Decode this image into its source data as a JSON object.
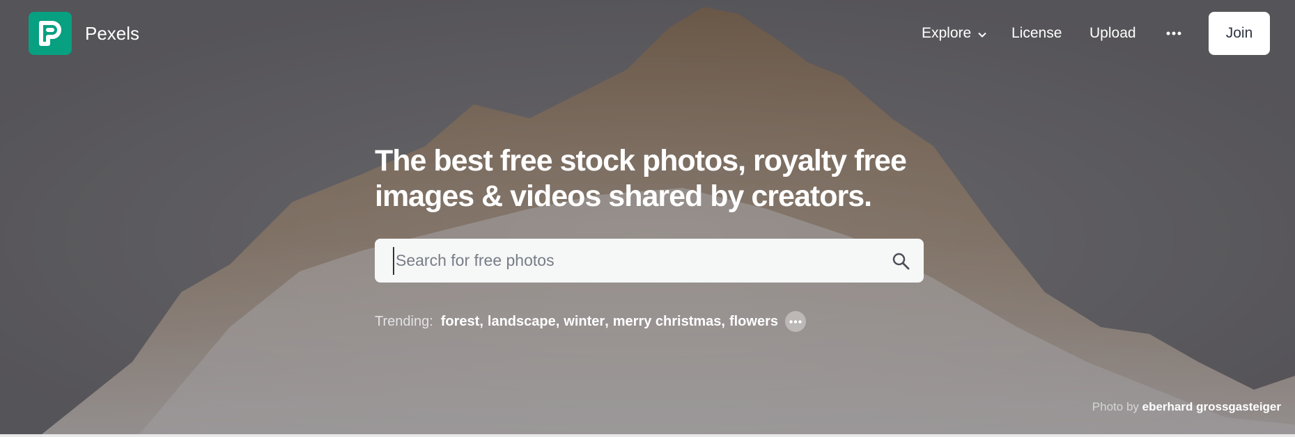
{
  "header": {
    "brand": "Pexels",
    "nav": {
      "explore": "Explore",
      "license": "License",
      "upload": "Upload",
      "join": "Join"
    }
  },
  "hero": {
    "headline": "The best free stock photos, royalty free images & videos shared by creators.",
    "search": {
      "placeholder": "Search for free photos",
      "value": ""
    },
    "trending": {
      "label": "Trending:",
      "items": [
        "forest",
        "landscape",
        "winter",
        "merry christmas",
        "flowers"
      ]
    },
    "credit": {
      "prefix": "Photo by",
      "author": "eberhard grossgasteiger"
    }
  },
  "colors": {
    "brand_green": "#07a081",
    "join_bg": "#ffffff",
    "search_bg": "#f6f7f7"
  },
  "icons": [
    "pexels-logo-icon",
    "chevron-down-icon",
    "more-icon",
    "search-icon",
    "trending-more-icon"
  ]
}
